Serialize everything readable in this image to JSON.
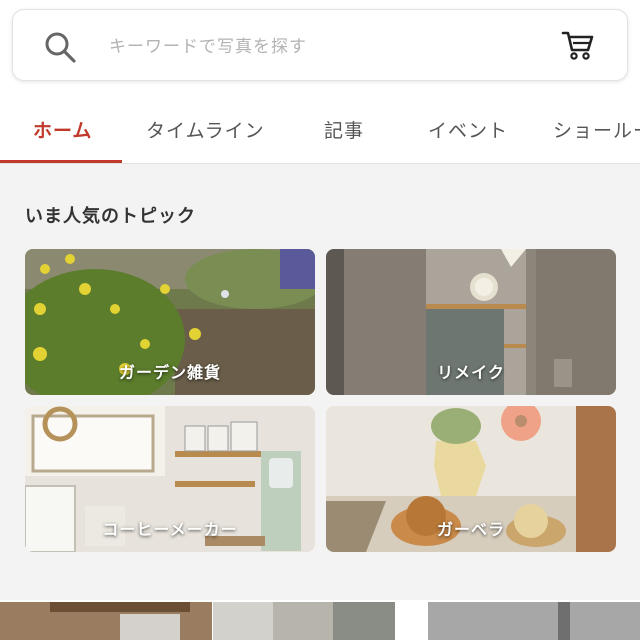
{
  "search": {
    "placeholder": "キーワードで写真を探す",
    "icon": "search-icon",
    "cart_icon": "cart-icon"
  },
  "tabs": [
    {
      "label": "ホーム",
      "active": true
    },
    {
      "label": "タイムライン",
      "active": false
    },
    {
      "label": "記事",
      "active": false
    },
    {
      "label": "イベント",
      "active": false
    },
    {
      "label": "ショールーム",
      "active": false
    }
  ],
  "topics": {
    "title": "いま人気のトピック",
    "items": [
      {
        "label": "ガーデン雑貨"
      },
      {
        "label": "リメイク"
      },
      {
        "label": "コーヒーメーカー"
      },
      {
        "label": "ガーベラ"
      }
    ]
  },
  "colors": {
    "accent": "#c0392b",
    "background": "#f3f3f3"
  }
}
